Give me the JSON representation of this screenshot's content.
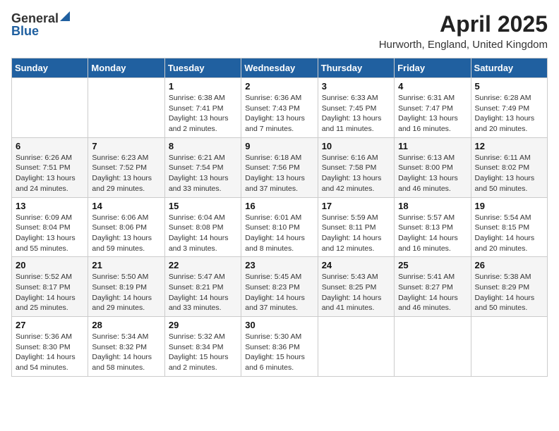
{
  "header": {
    "logo_general": "General",
    "logo_blue": "Blue",
    "title": "April 2025",
    "subtitle": "Hurworth, England, United Kingdom"
  },
  "days_of_week": [
    "Sunday",
    "Monday",
    "Tuesday",
    "Wednesday",
    "Thursday",
    "Friday",
    "Saturday"
  ],
  "weeks": [
    [
      {
        "day": "",
        "info": ""
      },
      {
        "day": "",
        "info": ""
      },
      {
        "day": "1",
        "info": "Sunrise: 6:38 AM\nSunset: 7:41 PM\nDaylight: 13 hours and 2 minutes."
      },
      {
        "day": "2",
        "info": "Sunrise: 6:36 AM\nSunset: 7:43 PM\nDaylight: 13 hours and 7 minutes."
      },
      {
        "day": "3",
        "info": "Sunrise: 6:33 AM\nSunset: 7:45 PM\nDaylight: 13 hours and 11 minutes."
      },
      {
        "day": "4",
        "info": "Sunrise: 6:31 AM\nSunset: 7:47 PM\nDaylight: 13 hours and 16 minutes."
      },
      {
        "day": "5",
        "info": "Sunrise: 6:28 AM\nSunset: 7:49 PM\nDaylight: 13 hours and 20 minutes."
      }
    ],
    [
      {
        "day": "6",
        "info": "Sunrise: 6:26 AM\nSunset: 7:51 PM\nDaylight: 13 hours and 24 minutes."
      },
      {
        "day": "7",
        "info": "Sunrise: 6:23 AM\nSunset: 7:52 PM\nDaylight: 13 hours and 29 minutes."
      },
      {
        "day": "8",
        "info": "Sunrise: 6:21 AM\nSunset: 7:54 PM\nDaylight: 13 hours and 33 minutes."
      },
      {
        "day": "9",
        "info": "Sunrise: 6:18 AM\nSunset: 7:56 PM\nDaylight: 13 hours and 37 minutes."
      },
      {
        "day": "10",
        "info": "Sunrise: 6:16 AM\nSunset: 7:58 PM\nDaylight: 13 hours and 42 minutes."
      },
      {
        "day": "11",
        "info": "Sunrise: 6:13 AM\nSunset: 8:00 PM\nDaylight: 13 hours and 46 minutes."
      },
      {
        "day": "12",
        "info": "Sunrise: 6:11 AM\nSunset: 8:02 PM\nDaylight: 13 hours and 50 minutes."
      }
    ],
    [
      {
        "day": "13",
        "info": "Sunrise: 6:09 AM\nSunset: 8:04 PM\nDaylight: 13 hours and 55 minutes."
      },
      {
        "day": "14",
        "info": "Sunrise: 6:06 AM\nSunset: 8:06 PM\nDaylight: 13 hours and 59 minutes."
      },
      {
        "day": "15",
        "info": "Sunrise: 6:04 AM\nSunset: 8:08 PM\nDaylight: 14 hours and 3 minutes."
      },
      {
        "day": "16",
        "info": "Sunrise: 6:01 AM\nSunset: 8:10 PM\nDaylight: 14 hours and 8 minutes."
      },
      {
        "day": "17",
        "info": "Sunrise: 5:59 AM\nSunset: 8:11 PM\nDaylight: 14 hours and 12 minutes."
      },
      {
        "day": "18",
        "info": "Sunrise: 5:57 AM\nSunset: 8:13 PM\nDaylight: 14 hours and 16 minutes."
      },
      {
        "day": "19",
        "info": "Sunrise: 5:54 AM\nSunset: 8:15 PM\nDaylight: 14 hours and 20 minutes."
      }
    ],
    [
      {
        "day": "20",
        "info": "Sunrise: 5:52 AM\nSunset: 8:17 PM\nDaylight: 14 hours and 25 minutes."
      },
      {
        "day": "21",
        "info": "Sunrise: 5:50 AM\nSunset: 8:19 PM\nDaylight: 14 hours and 29 minutes."
      },
      {
        "day": "22",
        "info": "Sunrise: 5:47 AM\nSunset: 8:21 PM\nDaylight: 14 hours and 33 minutes."
      },
      {
        "day": "23",
        "info": "Sunrise: 5:45 AM\nSunset: 8:23 PM\nDaylight: 14 hours and 37 minutes."
      },
      {
        "day": "24",
        "info": "Sunrise: 5:43 AM\nSunset: 8:25 PM\nDaylight: 14 hours and 41 minutes."
      },
      {
        "day": "25",
        "info": "Sunrise: 5:41 AM\nSunset: 8:27 PM\nDaylight: 14 hours and 46 minutes."
      },
      {
        "day": "26",
        "info": "Sunrise: 5:38 AM\nSunset: 8:29 PM\nDaylight: 14 hours and 50 minutes."
      }
    ],
    [
      {
        "day": "27",
        "info": "Sunrise: 5:36 AM\nSunset: 8:30 PM\nDaylight: 14 hours and 54 minutes."
      },
      {
        "day": "28",
        "info": "Sunrise: 5:34 AM\nSunset: 8:32 PM\nDaylight: 14 hours and 58 minutes."
      },
      {
        "day": "29",
        "info": "Sunrise: 5:32 AM\nSunset: 8:34 PM\nDaylight: 15 hours and 2 minutes."
      },
      {
        "day": "30",
        "info": "Sunrise: 5:30 AM\nSunset: 8:36 PM\nDaylight: 15 hours and 6 minutes."
      },
      {
        "day": "",
        "info": ""
      },
      {
        "day": "",
        "info": ""
      },
      {
        "day": "",
        "info": ""
      }
    ]
  ]
}
